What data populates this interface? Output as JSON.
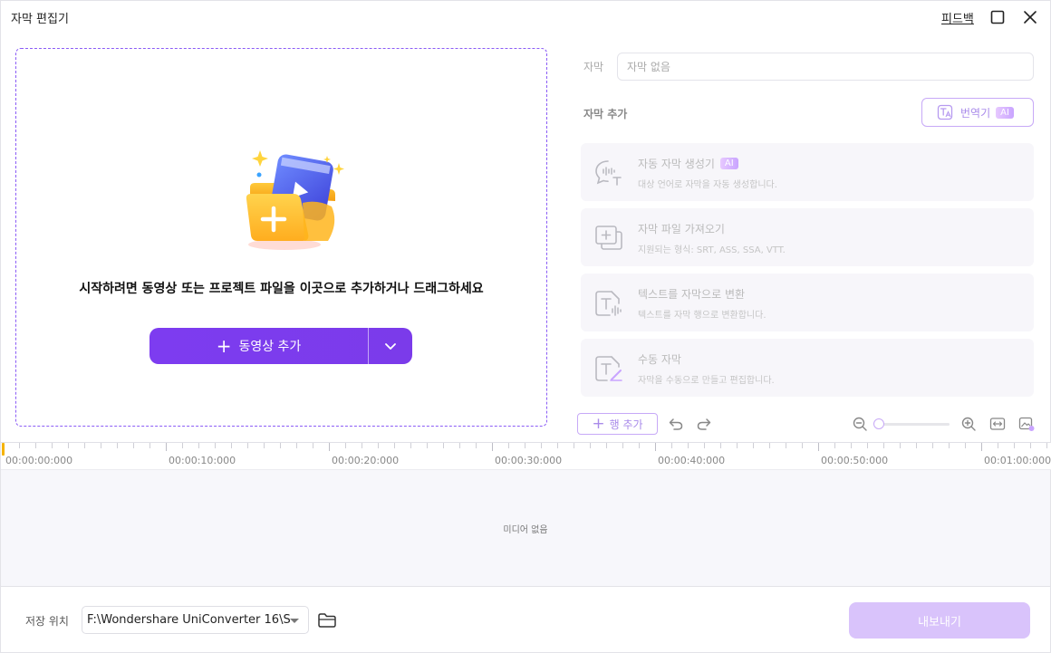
{
  "window": {
    "title": "자막 편집기",
    "feedback": "피드백",
    "maximize_icon": "maximize-icon",
    "close_icon": "close-icon"
  },
  "dropzone": {
    "instruction": "시작하려면 동영상 또는 프로젝트 파일을 이곳으로 추가하거나 드래그하세요",
    "add_video_label": "동영상 추가",
    "add_icon": "plus-icon",
    "dropdown_icon": "chevron-down-icon",
    "accent_color": "#7c3aed"
  },
  "subtitle_panel": {
    "subtitle_label": "자막",
    "subtitle_placeholder": "자막 없음",
    "add_subtitle_label": "자막 추가",
    "translator_label": "번역기",
    "ai_badge": "AI",
    "options": [
      {
        "title": "자동 자막 생성기",
        "badge": "AI",
        "desc": "대상 언어로 자막을 자동 생성합니다.",
        "icon": "speech-bubble-icon"
      },
      {
        "title": "자막 파일 가져오기",
        "badge": "",
        "desc": "지원되는 형식: SRT, ASS, SSA, VTT.",
        "icon": "import-file-icon"
      },
      {
        "title": "텍스트를 자막으로 변환",
        "badge": "",
        "desc": "텍스트를 자막 행으로 변환합니다.",
        "icon": "text-to-audio-icon"
      },
      {
        "title": "수동 자막",
        "badge": "",
        "desc": "자막을 수동으로 만들고 편집합니다.",
        "icon": "manual-edit-icon"
      }
    ]
  },
  "toolbar": {
    "add_row_label": "행 추가",
    "zoom_level": 0
  },
  "timeline": {
    "labels": [
      "00:00:00:000",
      "00:00:10:000",
      "00:00:20:000",
      "00:00:30:000",
      "00:00:40:000",
      "00:00:50:000",
      "00:01:00:000"
    ],
    "empty_text": "미디어 없음"
  },
  "footer": {
    "save_location_label": "저장 위치",
    "save_path": "F:\\Wondershare UniConverter 16\\S",
    "export_label": "내보내기",
    "export_color": "#d9c3fb"
  }
}
